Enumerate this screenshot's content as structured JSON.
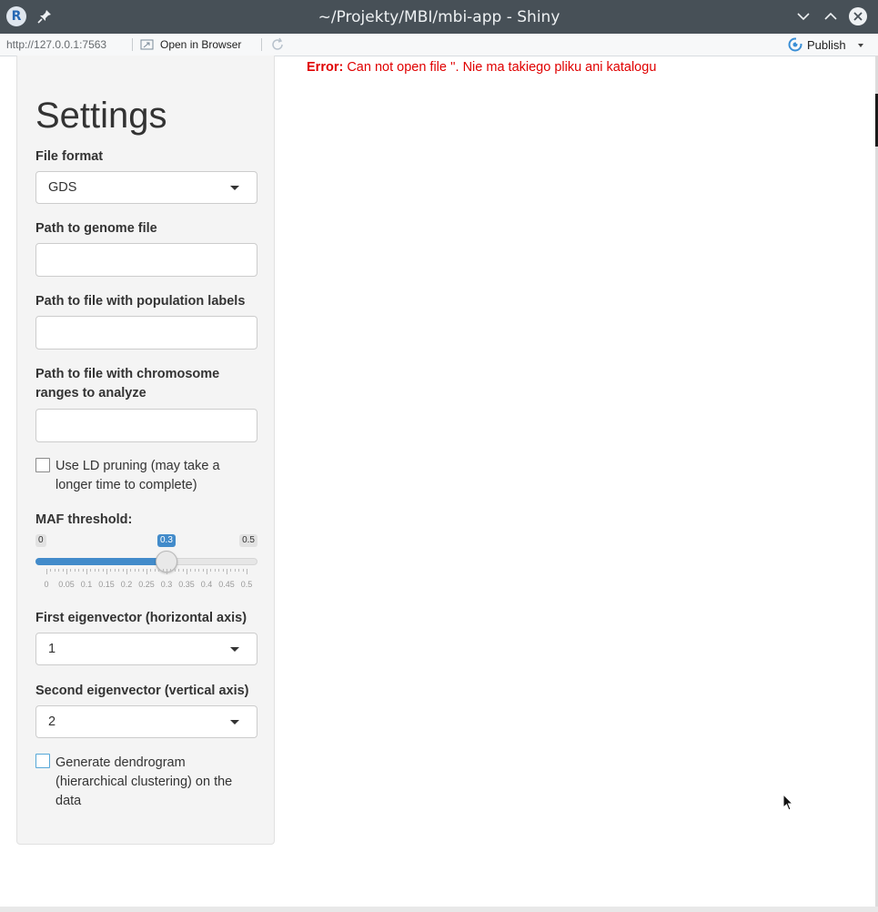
{
  "window": {
    "title": "~/Projekty/MBI/mbi-app - Shiny",
    "app_icon_letter": "R"
  },
  "toolbar": {
    "url": "http://127.0.0.1:7563",
    "open_browser_label": "Open in Browser",
    "publish_label": "Publish"
  },
  "sidebar": {
    "heading": "Settings",
    "file_format": {
      "label": "File format",
      "value": "GDS"
    },
    "genome_path": {
      "label": "Path to genome file",
      "value": ""
    },
    "population_path": {
      "label": "Path to file with population labels",
      "value": ""
    },
    "ranges_path": {
      "label": "Path to file with chromosome ranges to analyze",
      "value": ""
    },
    "ld_pruning": {
      "label": "Use LD pruning (may take a longer time to complete)",
      "checked": false
    },
    "maf": {
      "label": "MAF threshold:",
      "min_label": "0",
      "max_label": "0.5",
      "value_label": "0.3",
      "min": 0,
      "max": 0.5,
      "value": 0.3,
      "tick_labels": [
        "0",
        "0.05",
        "0.1",
        "0.15",
        "0.2",
        "0.25",
        "0.3",
        "0.35",
        "0.4",
        "0.45",
        "0.5"
      ]
    },
    "first_eigenvector": {
      "label": "First eigenvector (horizontal axis)",
      "value": "1"
    },
    "second_eigenvector": {
      "label": "Second eigenvector (vertical axis)",
      "value": "2"
    },
    "dendrogram": {
      "label": "Generate dendrogram (hierarchical clustering) on the data",
      "checked": false
    }
  },
  "main": {
    "error_prefix": "Error:",
    "error_message": "Can not open file ''. Nie ma takiego pliku ani katalogu"
  },
  "colors": {
    "titlebar": "#475057",
    "slider_accent": "#428bca",
    "error": "#e00000"
  }
}
